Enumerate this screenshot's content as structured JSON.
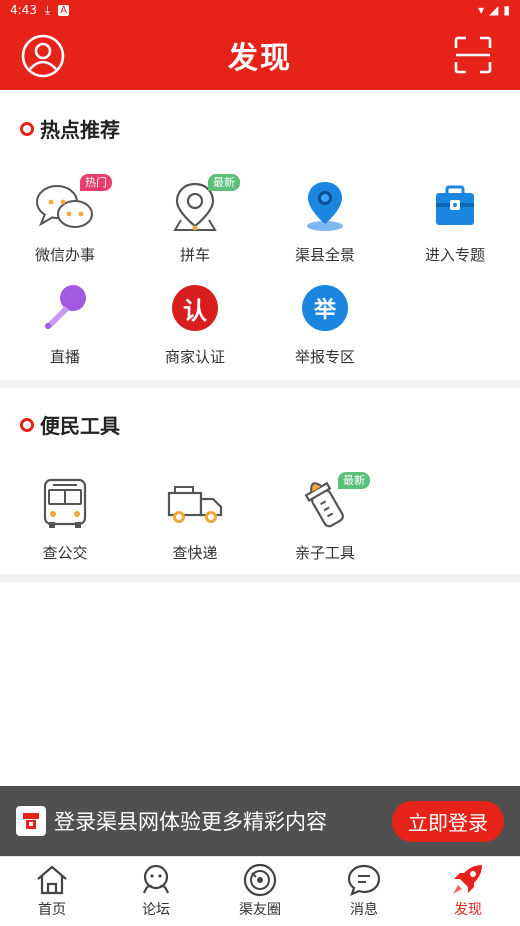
{
  "status_bar": {
    "time": "4:43"
  },
  "header": {
    "title": "发现"
  },
  "sections": [
    {
      "title": "热点推荐",
      "items": [
        {
          "label": "微信办事",
          "icon": "wechat-chat-icon",
          "badge": "热门"
        },
        {
          "label": "拼车",
          "icon": "carpool-pin-icon",
          "badge": "最新"
        },
        {
          "label": "渠县全景",
          "icon": "location-pin-icon",
          "badge": ""
        },
        {
          "label": "进入专题",
          "icon": "briefcase-icon",
          "badge": ""
        },
        {
          "label": "直播",
          "icon": "microphone-icon",
          "badge": ""
        },
        {
          "label": "商家认证",
          "icon": "merchant-cert-icon",
          "badge": "",
          "glyph": "认"
        },
        {
          "label": "举报专区",
          "icon": "report-icon",
          "badge": "",
          "glyph": "举"
        }
      ]
    },
    {
      "title": "便民工具",
      "items": [
        {
          "label": "查公交",
          "icon": "bus-icon",
          "badge": ""
        },
        {
          "label": "查快递",
          "icon": "delivery-truck-icon",
          "badge": ""
        },
        {
          "label": "亲子工具",
          "icon": "baby-bottle-icon",
          "badge": "最新"
        }
      ]
    }
  ],
  "login_banner": {
    "text": "登录渠县网体验更多精彩内容",
    "button": "立即登录"
  },
  "tabbar": [
    {
      "label": "首页",
      "icon": "home-icon",
      "active": false
    },
    {
      "label": "论坛",
      "icon": "forum-icon",
      "active": false
    },
    {
      "label": "渠友圈",
      "icon": "circle-icon",
      "active": false
    },
    {
      "label": "消息",
      "icon": "message-icon",
      "active": false
    },
    {
      "label": "发现",
      "icon": "rocket-icon",
      "active": true
    }
  ],
  "colors": {
    "brand_red": "#e5231a",
    "hot_badge": "#e83e6c",
    "new_badge": "#5cbf7a"
  }
}
